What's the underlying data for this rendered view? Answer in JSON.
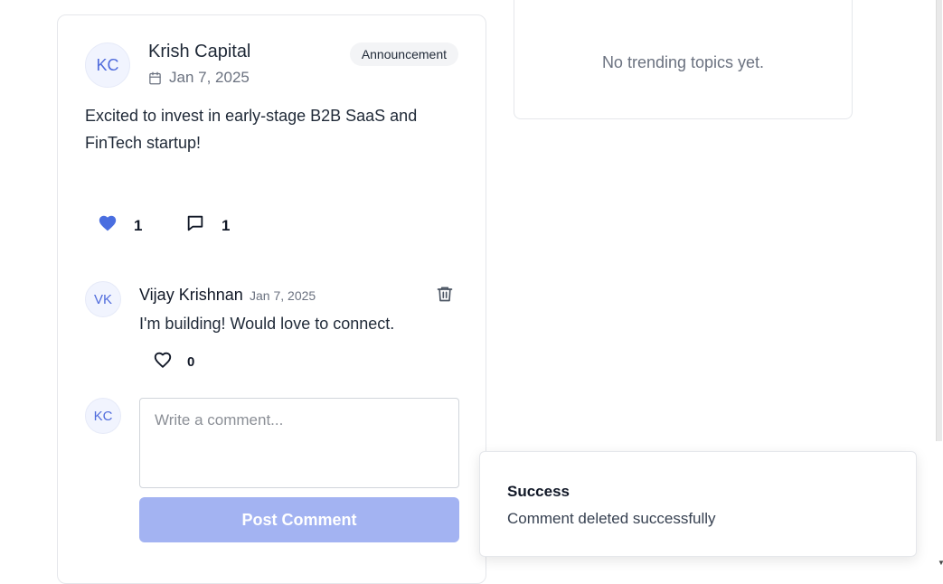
{
  "post": {
    "author_initials": "KC",
    "author_name": "Krish Capital",
    "date": "Jan 7, 2025",
    "tag": "Announcement",
    "body": "Excited to invest in early-stage B2B SaaS and FinTech startup!",
    "likes": "1",
    "comments": "1",
    "liked": true
  },
  "comment": {
    "author_initials": "VK",
    "author_name": "Vijay Krishnan",
    "date": "Jan 7, 2025",
    "text": "I'm building! Would love to connect.",
    "likes": "0"
  },
  "composer": {
    "user_initials": "KC",
    "placeholder": "Write a comment...",
    "submit_label": "Post Comment"
  },
  "trending": {
    "empty_text": "No trending topics yet."
  },
  "toast": {
    "title": "Success",
    "message": "Comment deleted successfully"
  },
  "colors": {
    "accent": "#4f6bdc",
    "button_disabled": "#a3b3f2",
    "heart_filled": "#4a6ee0"
  }
}
